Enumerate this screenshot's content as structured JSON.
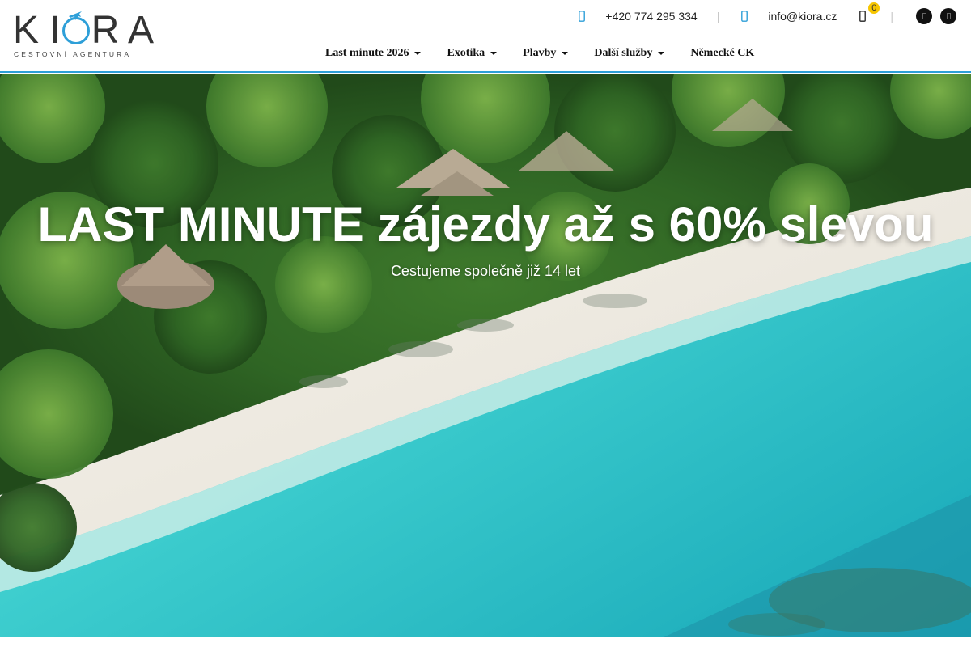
{
  "brand": {
    "logo_text": "KIORA",
    "logo_subtitle": "CESTOVNÍ AGENTURA",
    "accent_color": "#2e9fd8"
  },
  "topbar": {
    "phone": "+420 774 295 334",
    "phone_icon": "phone-icon",
    "email": "info@kiora.cz",
    "email_icon": "envelope-icon",
    "cart_icon": "cart-icon",
    "cart_count": "0",
    "separator": "|",
    "social": [
      {
        "icon": "facebook-icon"
      },
      {
        "icon": "instagram-icon"
      }
    ]
  },
  "nav": {
    "items": [
      {
        "label": "Last minute 2026",
        "dropdown": true
      },
      {
        "label": "Exotika",
        "dropdown": true
      },
      {
        "label": "Plavby",
        "dropdown": true
      },
      {
        "label": "Další služby",
        "dropdown": true
      },
      {
        "label": "Německé CK",
        "dropdown": false
      }
    ]
  },
  "hero": {
    "title": "LAST MINUTE zájezdy až s 60% slevou",
    "subtitle": "Cestujeme společně již 14 let"
  }
}
